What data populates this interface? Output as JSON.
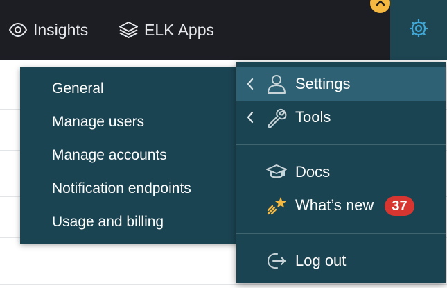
{
  "topbar": {
    "nav": [
      {
        "label": "Insights",
        "icon": "eye-icon"
      },
      {
        "label": "ELK Apps",
        "icon": "layers-icon"
      }
    ],
    "settings_icon": "gear-icon",
    "update_icon": "chevron-up-icon"
  },
  "settings_submenu": {
    "items": [
      "General",
      "Manage users",
      "Manage accounts",
      "Notification endpoints",
      "Usage and billing"
    ]
  },
  "main_menu": {
    "items": [
      {
        "label": "Settings",
        "icon": "user-icon",
        "has_submenu": true,
        "active": true
      },
      {
        "label": "Tools",
        "icon": "wrench-icon",
        "has_submenu": true,
        "active": false
      },
      {
        "label": "Docs",
        "icon": "graduation-cap-icon",
        "has_submenu": false,
        "active": false
      },
      {
        "label": "What’s new",
        "icon": "shooting-star-icon",
        "has_submenu": false,
        "active": false,
        "badge": "37"
      },
      {
        "label": "Log out",
        "icon": "logout-icon",
        "has_submenu": false,
        "active": false
      }
    ]
  },
  "colors": {
    "topbar_bg": "#1c1e23",
    "menu_bg": "#1b4452",
    "menu_active_bg": "#2d6173",
    "badge_red": "#d7352f",
    "badge_yellow": "#f5b942",
    "gear_accent": "#3fa8d8"
  }
}
